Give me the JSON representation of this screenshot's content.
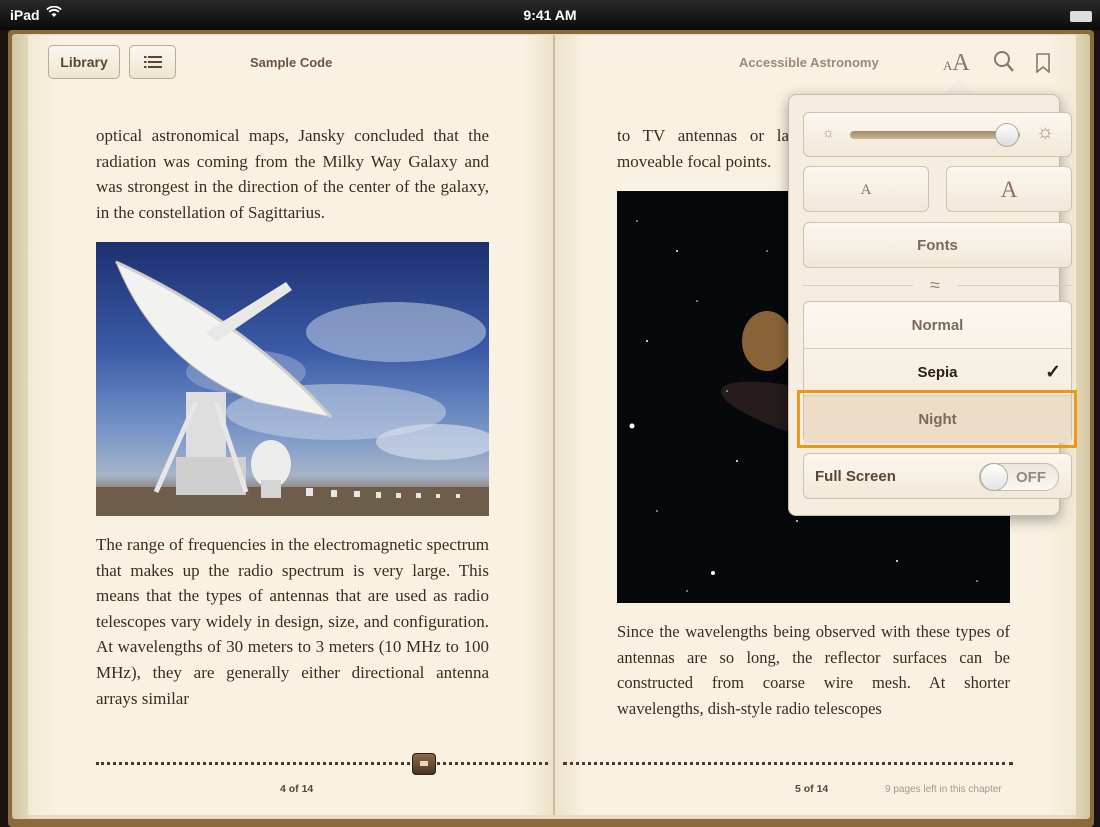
{
  "status_bar": {
    "carrier": "iPad",
    "time": "9:41 AM"
  },
  "left_page": {
    "library_label": "Library",
    "toc_icon": "list-icon",
    "title": "Sample Code",
    "paragraph1": "optical astronomical maps, Jansky concluded that the radiation was coming from the Milky Way Galaxy and was strongest in the direction of the center of the galaxy, in the constellation of Sagittarius.",
    "paragraph2": "The range of frequencies in the electromagnetic spectrum that makes up the radio spectrum is very large. This means that the types of antennas that are used as radio telescopes vary widely in design, size, and configuration. At wavelengths of 30 meters to 3 meters (10 MHz to 100 MHz), they are generally either directional antenna arrays similar",
    "page_number": "4 of 14"
  },
  "right_page": {
    "title": "Accessible Astronomy",
    "paragraph1": "to TV antennas or large stationary reflectors with moveable focal points.",
    "paragraph2": "Since the wavelengths being observed with these types of antennas are so long, the reflector surfaces can be constructed from coarse wire mesh. At shorter wavelengths, dish-style radio telescopes",
    "page_number": "5 of 14",
    "pages_left": "9 pages left in this chapter"
  },
  "toolbar_icons": [
    "font-size-icon",
    "search-icon",
    "bookmark-icon"
  ],
  "popover": {
    "brightness": 0.92,
    "font_small": "A",
    "font_large": "A",
    "fonts_label": "Fonts",
    "themes": [
      {
        "label": "Normal",
        "selected": false
      },
      {
        "label": "Sepia",
        "selected": true
      },
      {
        "label": "Night",
        "selected": false
      }
    ],
    "full_screen_label": "Full Screen",
    "full_screen_value": "OFF"
  },
  "highlight_color": "#f0951c"
}
